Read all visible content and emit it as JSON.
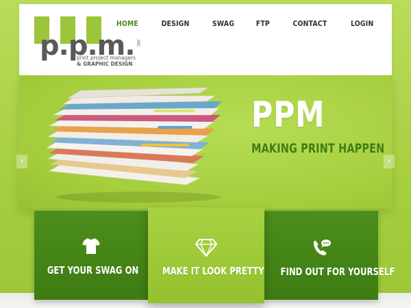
{
  "logo": {
    "letters": "p.p.m.",
    "inc": "INC",
    "tagline1": "print project managers",
    "tagline2": "& GRAPHIC DESIGN"
  },
  "nav": {
    "items": [
      {
        "label": "HOME",
        "active": true
      },
      {
        "label": "DESIGN",
        "active": false
      },
      {
        "label": "SWAG",
        "active": false
      },
      {
        "label": "FTP",
        "active": false
      },
      {
        "label": "CONTACT",
        "active": false
      },
      {
        "label": "LOGIN",
        "active": false
      }
    ]
  },
  "hero": {
    "title": "PPM",
    "subtitle": "MAKING PRINT HAPPEN",
    "prev_icon": "chevron-left-icon",
    "next_icon": "chevron-right-icon",
    "prev_glyph": "‹",
    "next_glyph": "›"
  },
  "features": [
    {
      "label": "GET YOUR SWAG ON",
      "icon": "tshirt-icon"
    },
    {
      "label": "MAKE IT LOOK PRETTY",
      "icon": "diamond-icon"
    },
    {
      "label": "FIND OUT FOR YOURSELF",
      "icon": "phone-chat-icon"
    }
  ],
  "colors": {
    "brand_green": "#a6cf3f",
    "dark_green": "#3d7c12",
    "nav_active": "#4d8a1f",
    "logo_gray": "#5a5a5a"
  }
}
